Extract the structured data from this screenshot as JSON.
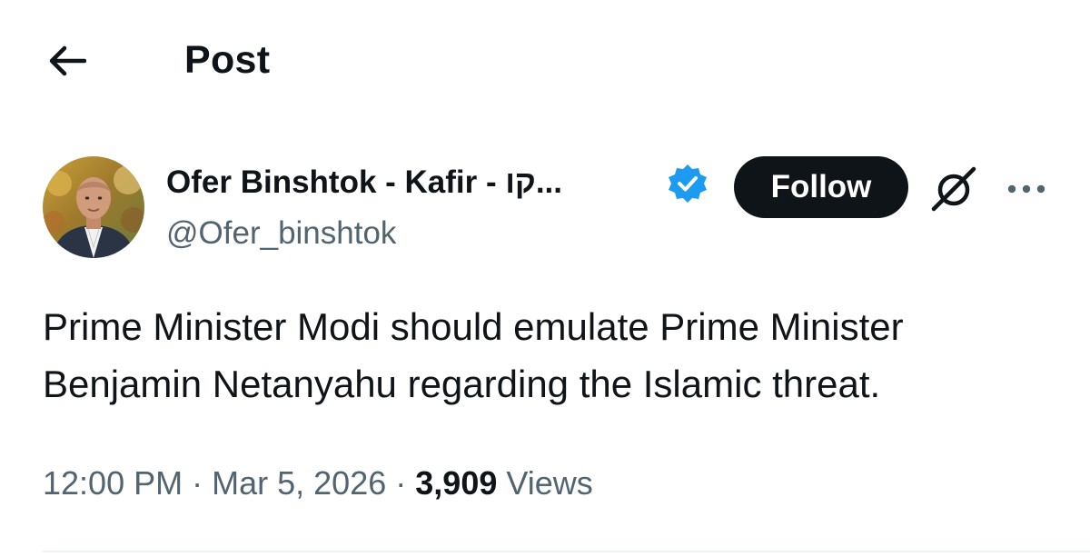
{
  "header": {
    "back_icon": "arrow-left-icon",
    "title": "Post"
  },
  "author": {
    "display_name": "Ofer Binshtok - Kafir - קו...",
    "handle": "@Ofer_binshtok",
    "verified": true,
    "verified_color": "#1d9bf0",
    "avatar_icon": "user-avatar"
  },
  "actions": {
    "follow_label": "Follow",
    "grok_icon": "grok-icon",
    "more_icon": "more-horizontal-icon"
  },
  "post": {
    "text": "Prime Minister Modi should emulate Prime Minister Benjamin Netanyahu regarding the Islamic threat."
  },
  "meta": {
    "time": "12:00 PM",
    "separator": "·",
    "date": "Mar 5, 2026",
    "views_count": "3,909",
    "views_label": "Views"
  },
  "colors": {
    "text_primary": "#0f1419",
    "text_secondary": "#536471",
    "follow_bg": "#0f1419",
    "verified": "#1d9bf0"
  }
}
